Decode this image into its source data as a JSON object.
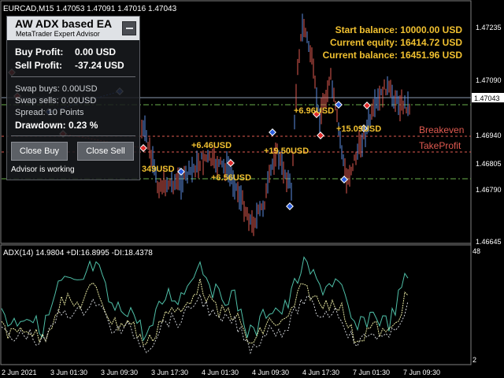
{
  "chart": {
    "symbol_label": "EURCAD,M15  1.47053 1.47091 1.47016 1.47043",
    "current_price": "1.47043",
    "price_ticks": [
      "1.47235",
      "1.47090",
      "1.46940",
      "1.46805",
      "1.46790",
      "1.46645"
    ],
    "price_ticks_visible": [
      "1.47235",
      "1.47090",
      "1.46940",
      "1.46805",
      "1.46790",
      "1.46645"
    ],
    "price_axis": [
      "1.47235",
      "1.47090",
      "1.47043",
      "1.46940",
      "1.46805",
      "1.46790",
      "1.46645"
    ],
    "price_labels": {
      "t1": "1.47235",
      "t2": "1.47090",
      "t3": "1.46940",
      "t4": "1.46805",
      "t5": "1.46790",
      "t6": "1.46645"
    },
    "time_labels": [
      "2 Jun 2021",
      "3 Jun 01:30",
      "3 Jun 09:30",
      "3 Jun 17:30",
      "4 Jun 01:30",
      "4 Jun 09:30",
      "4 Jun 17:30",
      "7 Jun 01:30",
      "7 Jun 09:30"
    ],
    "breakeven_label": "Breakeven",
    "takeprofit_label": "TakeProfit",
    "profit_labels": [
      "349USD",
      "+6.46USD",
      "+6.56USD",
      "+19.50USD",
      "+6.96USD",
      "+15.09USD"
    ],
    "colors": {
      "background": "#000000",
      "bull": "#5b8de0",
      "bear": "#e05a50",
      "label_orange": "#f0c030",
      "level_red": "#e05a50",
      "level_green": "#6ab04c",
      "adx": "#4fc0a8",
      "di_plus": "#e6e6a0",
      "di_minus": "#cfd2d6"
    }
  },
  "account": {
    "start_balance": "Start balance: 10000.00 USD",
    "current_equity": "Current equity: 16414.72 USD",
    "current_balance": "Current balance: 16451.96 USD"
  },
  "ea_panel": {
    "title": "AW ADX based EA",
    "subtitle": "MetaTrader Expert Advisor",
    "buy_profit_label": "Buy Profit:",
    "buy_profit_value": "0.00 USD",
    "sell_profit_label": "Sell Profit:",
    "sell_profit_value": "-37.24 USD",
    "swap_buys": "Swap buys: 0.00USD",
    "swap_sells": "Swap sells: 0.00USD",
    "spread": "Spread: 10 Points",
    "drawdown": "Drawdown: 0.23 %",
    "close_buy": "Close Buy",
    "close_sell": "Close Sell",
    "status": "Advisor is working",
    "minimize_icon": "minimize-icon"
  },
  "indicator": {
    "label": "ADX(14) 14.9804 +DI:16.8995 -DI:18.4378",
    "scale_max": "48",
    "scale_min": "2"
  }
}
